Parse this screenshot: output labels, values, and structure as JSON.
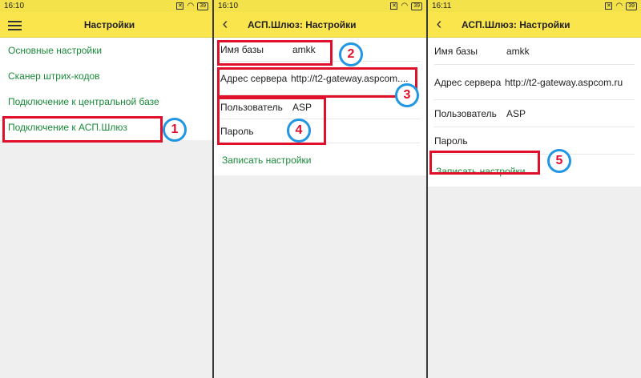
{
  "screen1": {
    "time": "16:10",
    "battery": "39",
    "title": "Настройки",
    "menu": [
      "Основные настройки",
      "Сканер штрих-кодов",
      "Подключение к центральной базе",
      "Подключение к АСП.Шлюз"
    ]
  },
  "screen2": {
    "time": "16:10",
    "battery": "39",
    "title": "АСП.Шлюз: Настройки",
    "fields": {
      "db_label": "Имя базы",
      "db_value": "amkk",
      "server_label": "Адрес сервера",
      "server_value": "http://t2-gateway.aspcom....",
      "user_label": "Пользователь",
      "user_value": "ASP",
      "password_label": "Пароль",
      "password_value": ""
    },
    "save_label": "Записать настройки"
  },
  "screen3": {
    "time": "16:11",
    "battery": "39",
    "title": "АСП.Шлюз: Настройки",
    "fields": {
      "db_label": "Имя базы",
      "db_value": "amkk",
      "server_label": "Адрес сервера",
      "server_value": "http://t2-gateway.aspcom.ru",
      "user_label": "Пользователь",
      "user_value": "ASP",
      "password_label": "Пароль",
      "password_value": ""
    },
    "save_label": "Записать настройки"
  },
  "badges": [
    "1",
    "2",
    "3",
    "4",
    "5"
  ],
  "colors": {
    "toolbar": "#fbe54d",
    "link": "#1a8a3a",
    "highlight": "#e0102a",
    "badge_ring": "#2196e3"
  }
}
